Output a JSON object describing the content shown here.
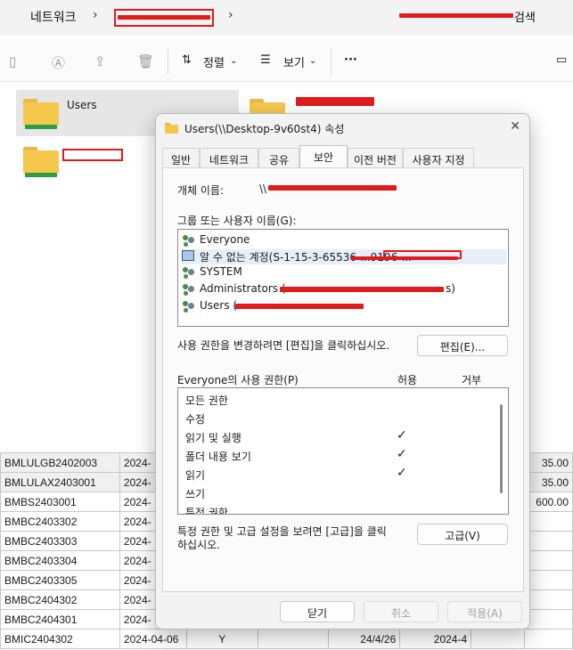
{
  "address": {
    "root": "네트워크",
    "search_suffix": "검색"
  },
  "toolbar": {
    "sort_label": "정렬",
    "view_label": "보기",
    "more_label": "···"
  },
  "files": {
    "folder1": "Users"
  },
  "sheet": {
    "rows": [
      [
        "BMLULGB2402003",
        "2024-",
        "",
        "",
        "",
        "",
        "",
        "35.00"
      ],
      [
        "BMLULAX2403001",
        "2024-",
        "",
        "",
        "",
        "",
        "",
        "35.00"
      ],
      [
        "BMBS2403001",
        "2024-",
        "",
        "",
        "",
        "",
        "",
        "600.00"
      ],
      [
        "BMBC2403302",
        "2024-",
        "",
        "",
        "",
        "",
        "",
        ""
      ],
      [
        "BMBC2403303",
        "2024-",
        "",
        "",
        "",
        "",
        "",
        ""
      ],
      [
        "BMBC2403304",
        "2024-",
        "",
        "",
        "",
        "",
        "",
        ""
      ],
      [
        "BMBC2403305",
        "2024-",
        "",
        "",
        "",
        "",
        "",
        ""
      ],
      [
        "BMBC2404302",
        "2024-",
        "",
        "",
        "",
        "",
        "",
        ""
      ],
      [
        "BMBC2404301",
        "2024-",
        "",
        "",
        "",
        "",
        "",
        ""
      ],
      [
        "BMIC2404302",
        "2024-04-06",
        "Y",
        "",
        "24/4/26",
        "2024-4",
        "",
        ""
      ]
    ]
  },
  "dialog": {
    "title": "Users(\\\\Desktop-9v60st4) 속성",
    "close": "✕",
    "tabs": [
      "일반",
      "네트워크",
      "공유",
      "보안",
      "이전 버전",
      "사용자 지정"
    ],
    "object_name_label": "개체 이름:",
    "object_name_value": "\\\\",
    "group_label": "그룹 또는 사용자 이름(G):",
    "users": [
      {
        "name": "Everyone",
        "icon": "users-icon"
      },
      {
        "name": "알 수 없는 계정(S-1-15-3-65536-...9196-...",
        "icon": "unknown-account-icon"
      },
      {
        "name": "SYSTEM",
        "icon": "users-icon"
      },
      {
        "name": "Administrators (",
        "suffix": "s)",
        "icon": "users-icon"
      },
      {
        "name": "Users (",
        "icon": "users-icon"
      }
    ],
    "edit_hint": "사용 권한을 변경하려면 [편집]을 클릭하십시오.",
    "edit_button": "편집(E)...",
    "perm_header": "Everyone의 사용 권한(P)",
    "allow_header": "허용",
    "deny_header": "거부",
    "permissions": [
      {
        "name": "모든 권한",
        "allow": false
      },
      {
        "name": "수정",
        "allow": false
      },
      {
        "name": "읽기 및 실행",
        "allow": true
      },
      {
        "name": "폴더 내용 보기",
        "allow": true
      },
      {
        "name": "읽기",
        "allow": true
      },
      {
        "name": "쓰기",
        "allow": false
      },
      {
        "name": "특정 권한",
        "allow": false
      }
    ],
    "advanced_hint_1": "특정 권한 및 고급 설정을 보려면 [고급]을 클릭",
    "advanced_hint_2": "하십시오.",
    "advanced_button": "고급(V)",
    "ok_button": "닫기",
    "cancel_button": "취소",
    "apply_button": "적용(A)"
  }
}
